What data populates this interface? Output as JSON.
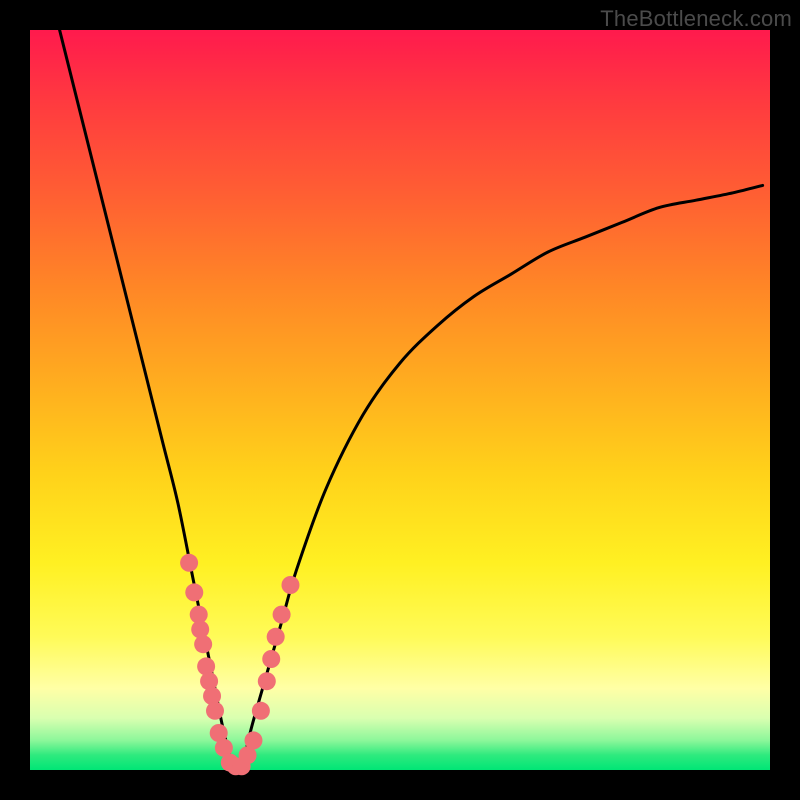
{
  "watermark": "TheBottleneck.com",
  "chart_data": {
    "type": "line",
    "title": "",
    "xlabel": "",
    "ylabel": "",
    "xlim": [
      0,
      100
    ],
    "ylim": [
      0,
      100
    ],
    "series": [
      {
        "name": "bottleneck-curve",
        "x": [
          4,
          6,
          8,
          10,
          12,
          14,
          16,
          18,
          20,
          22,
          23,
          24,
          25,
          26,
          27,
          28,
          29,
          30,
          32,
          34,
          36,
          40,
          45,
          50,
          55,
          60,
          65,
          70,
          75,
          80,
          85,
          90,
          95,
          99
        ],
        "y": [
          100,
          92,
          84,
          76,
          68,
          60,
          52,
          44,
          36,
          26,
          21,
          16,
          11,
          6,
          2,
          0,
          2,
          6,
          13,
          20,
          27,
          38,
          48,
          55,
          60,
          64,
          67,
          70,
          72,
          74,
          76,
          77,
          78,
          79
        ]
      }
    ],
    "markers": {
      "name": "data-points",
      "color": "#f06f75",
      "points": [
        {
          "x": 21.5,
          "y": 28
        },
        {
          "x": 22.2,
          "y": 24
        },
        {
          "x": 22.8,
          "y": 21
        },
        {
          "x": 23.0,
          "y": 19
        },
        {
          "x": 23.4,
          "y": 17
        },
        {
          "x": 23.8,
          "y": 14
        },
        {
          "x": 24.2,
          "y": 12
        },
        {
          "x": 24.6,
          "y": 10
        },
        {
          "x": 25.0,
          "y": 8
        },
        {
          "x": 25.5,
          "y": 5
        },
        {
          "x": 26.2,
          "y": 3
        },
        {
          "x": 27.0,
          "y": 1
        },
        {
          "x": 27.8,
          "y": 0.5
        },
        {
          "x": 28.6,
          "y": 0.5
        },
        {
          "x": 29.4,
          "y": 2
        },
        {
          "x": 30.2,
          "y": 4
        },
        {
          "x": 31.2,
          "y": 8
        },
        {
          "x": 32.0,
          "y": 12
        },
        {
          "x": 32.6,
          "y": 15
        },
        {
          "x": 33.2,
          "y": 18
        },
        {
          "x": 34.0,
          "y": 21
        },
        {
          "x": 35.2,
          "y": 25
        }
      ]
    },
    "gradient_stops": [
      {
        "pos": 0,
        "color": "#ff1a4d"
      },
      {
        "pos": 50,
        "color": "#ffae1f"
      },
      {
        "pos": 80,
        "color": "#fffb58"
      },
      {
        "pos": 100,
        "color": "#00e676"
      }
    ]
  }
}
